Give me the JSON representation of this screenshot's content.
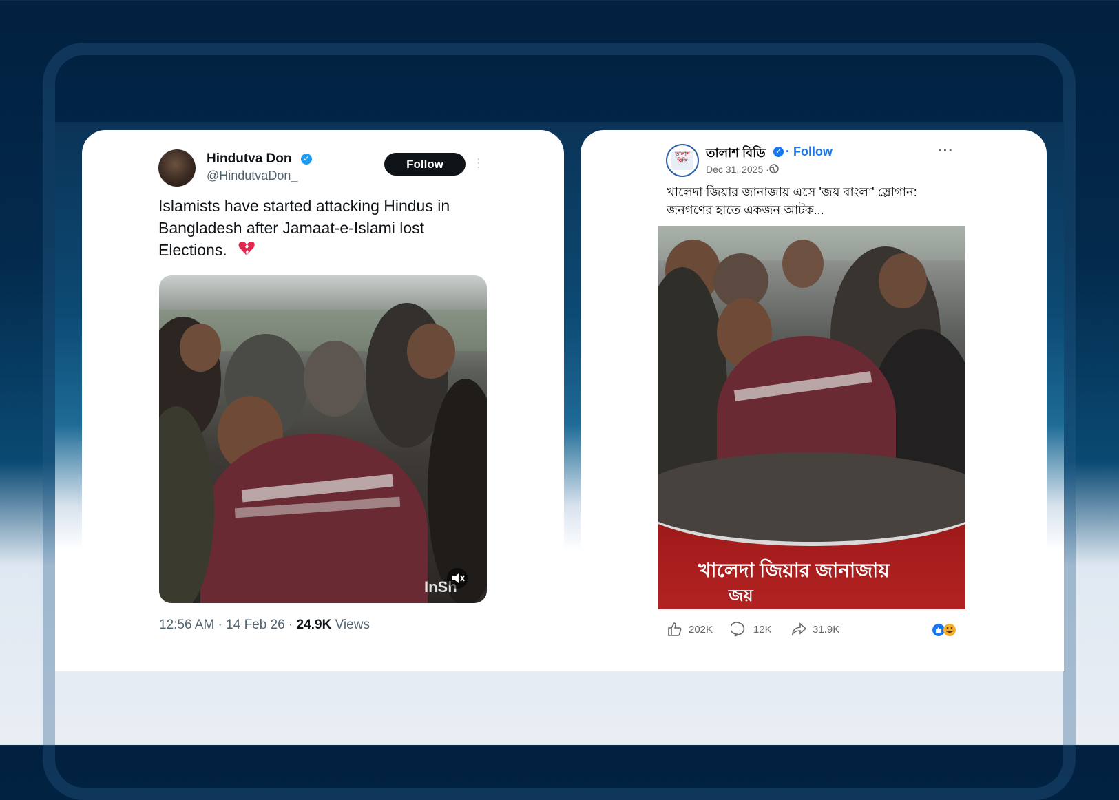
{
  "x_post": {
    "display_name": "Hindutva Don",
    "handle": "@HindutvaDon_",
    "follow_label": "Follow",
    "text": "Islamists have started attacking Hindus in Bangladesh after Jamaat-e-Islami lost Elections.",
    "emoji": "broken-heart-icon",
    "media_watermark": "InSh",
    "timestamp": "12:56 AM · 14 Feb 26 · ",
    "views_count": "24.9K",
    "views_label": " Views"
  },
  "fb_post": {
    "page_name": "তালাশ বিডি",
    "follow_label": "· Follow",
    "date": "Dec 31, 2025 ·",
    "more_label": "···",
    "text": "খালেদা জিয়ার জানাজায় এসে 'জয় বাংলা' স্লোগান: জনগণের হাতে একজন আটক...",
    "overlay_line1": "খালেদা জিয়ার জানাজায়",
    "overlay_line2": "জয়",
    "likes": "202K",
    "comments": "12K",
    "shares": "31.9K",
    "avatar_text": "তালাশ বিডি"
  },
  "colors": {
    "x_blue": "#1d9bf0",
    "fb_blue": "#1877f2",
    "banner_red": "#a51c1c"
  }
}
